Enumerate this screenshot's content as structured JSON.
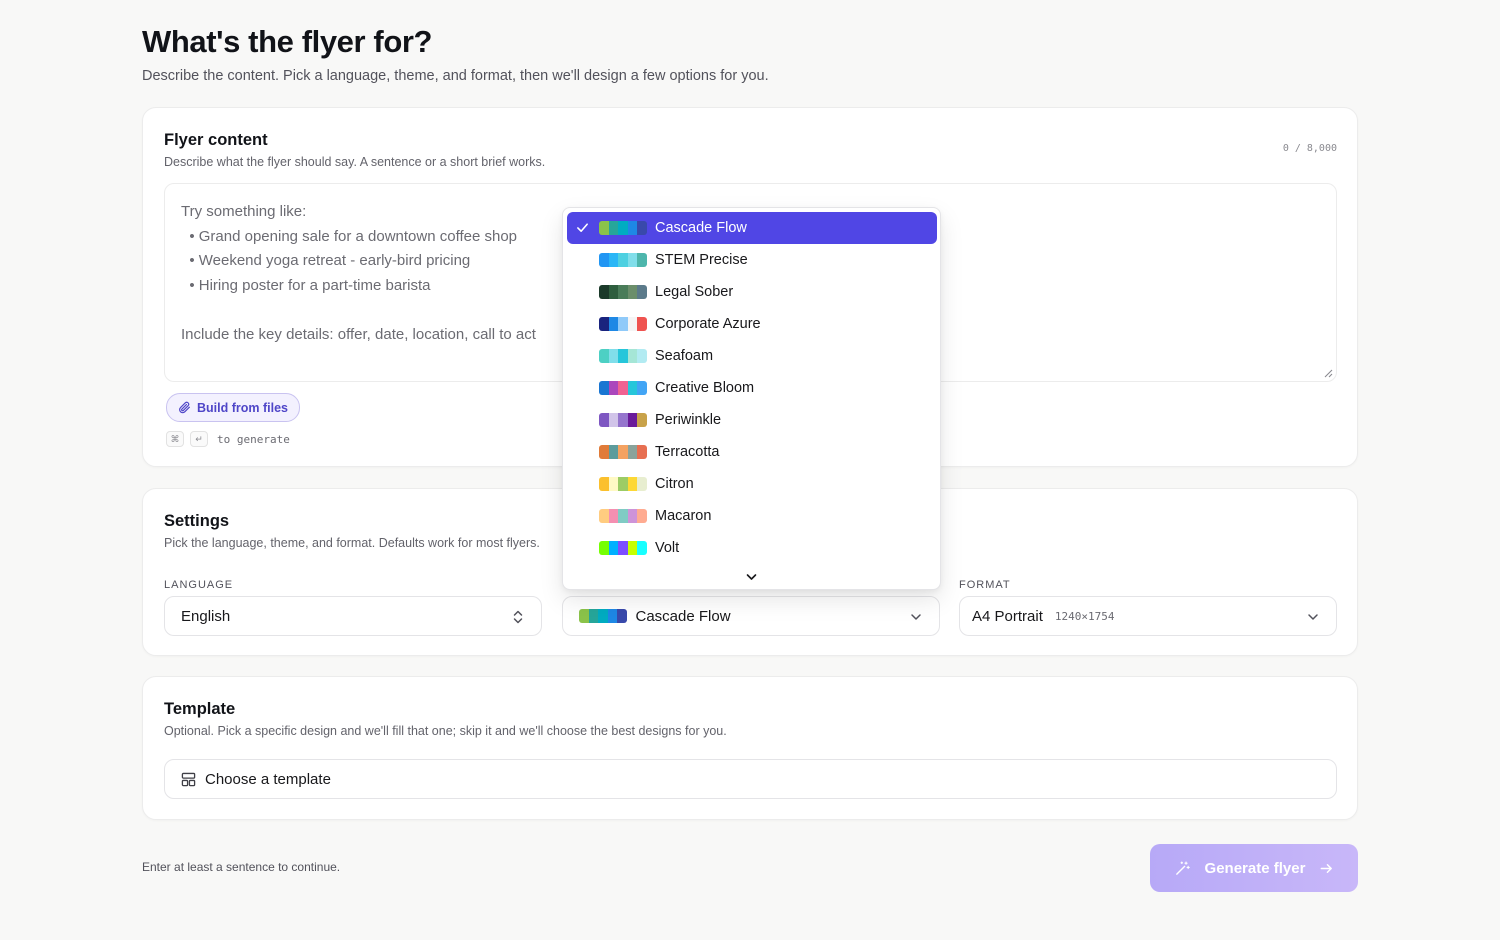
{
  "page": {
    "title": "What's the flyer for?",
    "subtitle": "Describe the content. Pick a language, theme, and format, then we'll design a few options for you."
  },
  "content_card": {
    "title": "Flyer content",
    "description": "Describe what the flyer should say. A sentence or a short brief works.",
    "counter": "0 / 8,000",
    "placeholder": "Try something like:\n  • Grand opening sale for a downtown coffee shop\n  • Weekend yoga retreat - early-bird pricing\n  • Hiring poster for a part-time barista\n\nInclude the key details: offer, date, location, call to act",
    "build_button": "Build from files",
    "shortcut_key1": "⌘",
    "shortcut_key2": "↵",
    "shortcut_text": "to generate"
  },
  "settings_card": {
    "title": "Settings",
    "description": "Pick the language, theme, and format. Defaults work for most flyers.",
    "language_label": "LANGUAGE",
    "language_value": "English",
    "theme_value": "Cascade Flow",
    "format_label": "FORMAT",
    "format_value": "A4 Portrait",
    "format_dims": "1240×1754"
  },
  "theme_dropdown": {
    "selected": "Cascade Flow",
    "options": [
      {
        "label": "Cascade Flow",
        "colors": [
          "#8bc34a",
          "#26a69a",
          "#00acc1",
          "#1e88e5",
          "#3949ab"
        ]
      },
      {
        "label": "STEM Precise",
        "colors": [
          "#2196f3",
          "#29b6f6",
          "#4dd0e1",
          "#80deea",
          "#4db6ac"
        ]
      },
      {
        "label": "Legal Sober",
        "colors": [
          "#1b3a2a",
          "#2e5e3e",
          "#4a7c59",
          "#6b8e6b",
          "#5b7a8a"
        ]
      },
      {
        "label": "Corporate Azure",
        "colors": [
          "#1a237e",
          "#1e88e5",
          "#90caf9",
          "#f5f5f5",
          "#ef5350"
        ]
      },
      {
        "label": "Seafoam",
        "colors": [
          "#4dd0c4",
          "#80deea",
          "#26c6da",
          "#a5e6d6",
          "#b2ebf2"
        ]
      },
      {
        "label": "Creative Bloom",
        "colors": [
          "#1976d2",
          "#ab47bc",
          "#f06292",
          "#26c6da",
          "#42a5f5"
        ]
      },
      {
        "label": "Periwinkle",
        "colors": [
          "#7e57c2",
          "#d1c4e9",
          "#9575cd",
          "#6a1b9a",
          "#c8a24a"
        ]
      },
      {
        "label": "Terracotta",
        "colors": [
          "#e07b39",
          "#5d9c9c",
          "#f4a261",
          "#8aa39b",
          "#e76f51"
        ]
      },
      {
        "label": "Citron",
        "colors": [
          "#fbc02d",
          "#fff9c4",
          "#9ccc65",
          "#fdd835",
          "#e8eed0"
        ]
      },
      {
        "label": "Macaron",
        "colors": [
          "#ffcc80",
          "#f48fb1",
          "#80cbc4",
          "#ce93d8",
          "#ffab91"
        ]
      },
      {
        "label": "Volt",
        "colors": [
          "#76ff03",
          "#00b0ff",
          "#7c4dff",
          "#c6ff00",
          "#18ffff"
        ]
      }
    ]
  },
  "template_card": {
    "title": "Template",
    "description": "Optional. Pick a specific design and we'll fill that one; skip it and we'll choose the best designs for you.",
    "button": "Choose a template"
  },
  "footer": {
    "note": "Enter at least a sentence to continue.",
    "generate_button": "Generate flyer"
  },
  "colors": {
    "accent": "#5046e5",
    "generate_gradient_start": "#b7a9f7",
    "generate_gradient_end": "#c8b7f9"
  },
  "icons": {
    "build_button": "paperclip-icon",
    "template_button": "layout-icon",
    "generate_button_left": "magic-wand-icon",
    "generate_button_right": "arrow-right-icon"
  }
}
